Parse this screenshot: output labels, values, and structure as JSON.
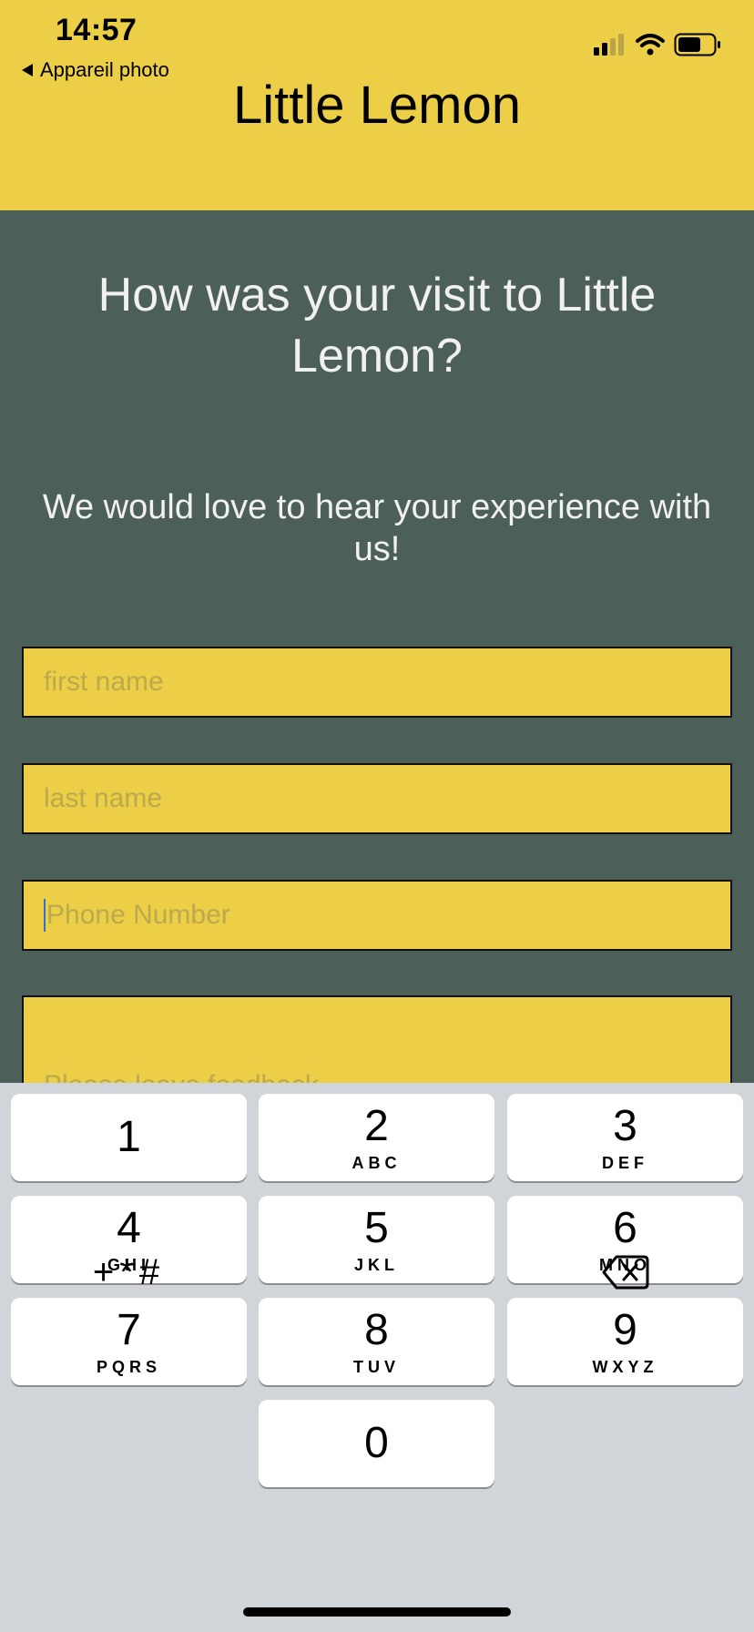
{
  "status_bar": {
    "time": "14:57",
    "back_label": "Appareil photo"
  },
  "header": {
    "title": "Little Lemon",
    "background": "#ecce47"
  },
  "main": {
    "heading": "How was your visit to Little Lemon?",
    "subheading": "We would love to hear your experience with us!",
    "background": "#4d5f59",
    "fields": {
      "first_name_placeholder": "first name",
      "last_name_placeholder": "last name",
      "phone_placeholder": "Phone Number",
      "feedback_placeholder": "Please leave feedback"
    }
  },
  "keyboard": {
    "keys": [
      {
        "num": "1",
        "letters": ""
      },
      {
        "num": "2",
        "letters": "ABC"
      },
      {
        "num": "3",
        "letters": "DEF"
      },
      {
        "num": "4",
        "letters": "GHI"
      },
      {
        "num": "5",
        "letters": "JKL"
      },
      {
        "num": "6",
        "letters": "MNO"
      },
      {
        "num": "7",
        "letters": "PQRS"
      },
      {
        "num": "8",
        "letters": "TUV"
      },
      {
        "num": "9",
        "letters": "WXYZ"
      },
      {
        "num": "0",
        "letters": ""
      }
    ],
    "symbols": "+*#",
    "backspace_icon": "backspace-icon"
  }
}
